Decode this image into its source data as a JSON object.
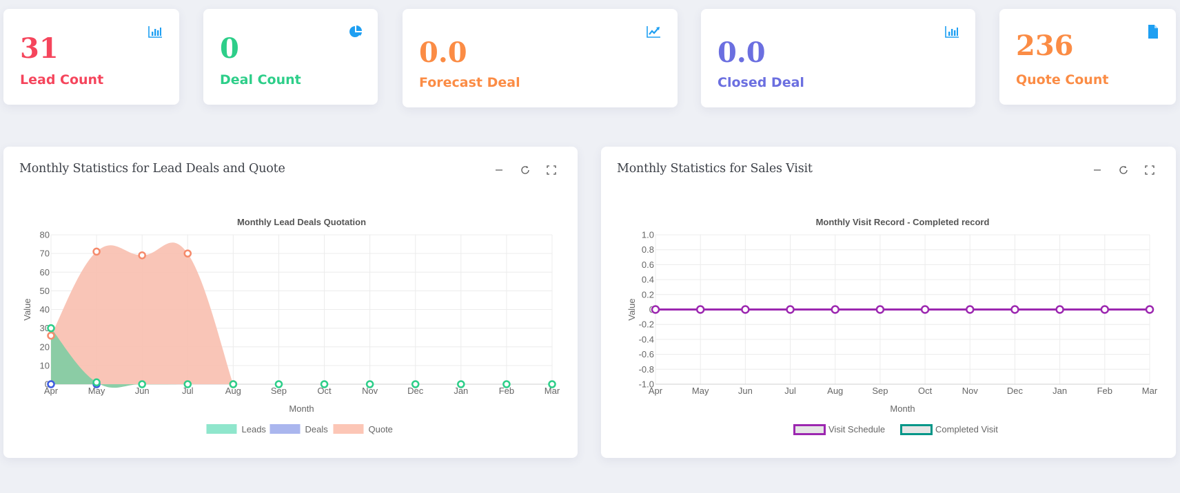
{
  "stats": [
    {
      "value": "31",
      "label": "Lead Count",
      "color": "#f5455c",
      "icon": "bar-chart-icon"
    },
    {
      "value": "0",
      "label": "Deal Count",
      "color": "#2dce89",
      "icon": "pie-chart-icon"
    },
    {
      "value": "0.0",
      "label": "Forecast Deal",
      "color": "#fb8c45",
      "icon": "line-chart-icon"
    },
    {
      "value": "0.0",
      "label": "Closed Deal",
      "color": "#6b6fe0",
      "icon": "bar-chart-icon"
    },
    {
      "value": "236",
      "label": "Quote Count",
      "color": "#fb8c45",
      "icon": "file-icon"
    }
  ],
  "icon_color": "#1e9ff2",
  "panels": [
    {
      "title": "Monthly Statistics for Lead Deals and Quote",
      "tools": [
        "minimize-icon",
        "refresh-icon",
        "expand-icon"
      ]
    },
    {
      "title": "Monthly Statistics for Sales Visit",
      "tools": [
        "minimize-icon",
        "refresh-icon",
        "expand-icon"
      ]
    }
  ],
  "chart_data": [
    {
      "type": "area",
      "title": "Monthly Lead Deals Quotation",
      "xlabel": "Month",
      "ylabel": "Value",
      "categories": [
        "Apr",
        "May",
        "Jun",
        "Jul",
        "Aug",
        "Sep",
        "Oct",
        "Nov",
        "Dec",
        "Jan",
        "Feb",
        "Mar"
      ],
      "ylim": [
        0,
        80
      ],
      "yticks": [
        0,
        10,
        20,
        30,
        40,
        50,
        60,
        70,
        80
      ],
      "grid": true,
      "legend": "bottom",
      "series": [
        {
          "name": "Leads",
          "values": [
            30,
            1,
            0,
            0,
            0,
            0,
            0,
            0,
            0,
            0,
            0,
            0
          ],
          "fill": "#8fe6cc",
          "area": "#85cca3",
          "stroke": "#2dce89"
        },
        {
          "name": "Deals",
          "values": [
            0,
            0,
            null,
            null,
            null,
            null,
            null,
            null,
            null,
            null,
            null,
            null
          ],
          "fill": "#aab6ee",
          "area": "#aab6ee",
          "stroke": "#3d5ce0"
        },
        {
          "name": "Quote",
          "values": [
            26,
            71,
            69,
            70,
            0,
            null,
            null,
            null,
            null,
            null,
            null,
            null
          ],
          "fill": "#fcc6b6",
          "area": "#f9c2b3",
          "stroke": "#f58a6b"
        }
      ]
    },
    {
      "type": "line",
      "title": "Monthly Visit Record - Completed record",
      "xlabel": "Month",
      "ylabel": "Value",
      "categories": [
        "Apr",
        "May",
        "Jun",
        "Jul",
        "Aug",
        "Sep",
        "Oct",
        "Nov",
        "Dec",
        "Jan",
        "Feb",
        "Mar"
      ],
      "ylim": [
        -1.0,
        1.0
      ],
      "yticks": [
        "-1.0",
        "-0.8",
        "-0.6",
        "-0.4",
        "-0.2",
        "0",
        "0.2",
        "0.4",
        "0.6",
        "0.8",
        "1.0"
      ],
      "grid": true,
      "legend": "bottom",
      "series": [
        {
          "name": "Visit Schedule",
          "values": [
            0,
            0,
            0,
            0,
            0,
            0,
            0,
            0,
            0,
            0,
            0,
            0
          ],
          "stroke": "#9c27b0"
        },
        {
          "name": "Completed Visit",
          "values": [
            0,
            0,
            0,
            0,
            0,
            0,
            0,
            0,
            0,
            0,
            0,
            0
          ],
          "stroke": "#009688"
        }
      ]
    }
  ]
}
